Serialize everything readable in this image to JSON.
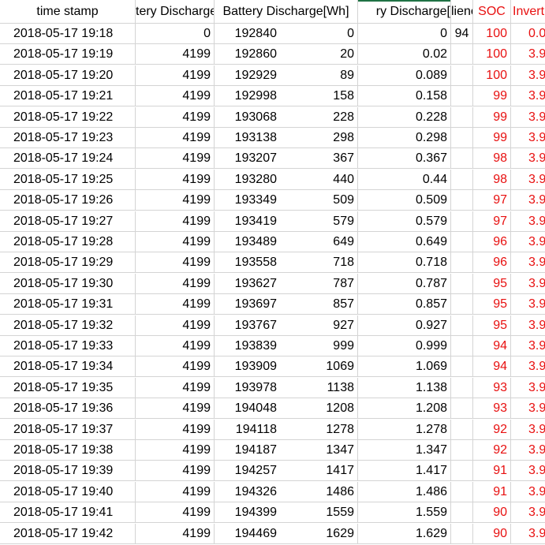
{
  "headers": {
    "timestamp": "time stamp",
    "col2": "tery Discharge",
    "col3": "Battery Discharge[Wh]",
    "col4": "ry Discharge[",
    "col5": "lienc",
    "soc": "SOC",
    "col7": "Invert"
  },
  "rows": [
    {
      "ts": "2018-05-17 19:18",
      "a": "0",
      "b": "192840",
      "c": "0",
      "d": "0",
      "e": "94",
      "soc": "100",
      "f": "0.0"
    },
    {
      "ts": "2018-05-17 19:19",
      "a": "4199",
      "b": "192860",
      "c": "20",
      "d": "0.02",
      "e": "",
      "soc": "100",
      "f": "3.9"
    },
    {
      "ts": "2018-05-17 19:20",
      "a": "4199",
      "b": "192929",
      "c": "89",
      "d": "0.089",
      "e": "",
      "soc": "100",
      "f": "3.9"
    },
    {
      "ts": "2018-05-17 19:21",
      "a": "4199",
      "b": "192998",
      "c": "158",
      "d": "0.158",
      "e": "",
      "soc": "99",
      "f": "3.9"
    },
    {
      "ts": "2018-05-17 19:22",
      "a": "4199",
      "b": "193068",
      "c": "228",
      "d": "0.228",
      "e": "",
      "soc": "99",
      "f": "3.9"
    },
    {
      "ts": "2018-05-17 19:23",
      "a": "4199",
      "b": "193138",
      "c": "298",
      "d": "0.298",
      "e": "",
      "soc": "99",
      "f": "3.9"
    },
    {
      "ts": "2018-05-17 19:24",
      "a": "4199",
      "b": "193207",
      "c": "367",
      "d": "0.367",
      "e": "",
      "soc": "98",
      "f": "3.9"
    },
    {
      "ts": "2018-05-17 19:25",
      "a": "4199",
      "b": "193280",
      "c": "440",
      "d": "0.44",
      "e": "",
      "soc": "98",
      "f": "3.9"
    },
    {
      "ts": "2018-05-17 19:26",
      "a": "4199",
      "b": "193349",
      "c": "509",
      "d": "0.509",
      "e": "",
      "soc": "97",
      "f": "3.9"
    },
    {
      "ts": "2018-05-17 19:27",
      "a": "4199",
      "b": "193419",
      "c": "579",
      "d": "0.579",
      "e": "",
      "soc": "97",
      "f": "3.9"
    },
    {
      "ts": "2018-05-17 19:28",
      "a": "4199",
      "b": "193489",
      "c": "649",
      "d": "0.649",
      "e": "",
      "soc": "96",
      "f": "3.9"
    },
    {
      "ts": "2018-05-17 19:29",
      "a": "4199",
      "b": "193558",
      "c": "718",
      "d": "0.718",
      "e": "",
      "soc": "96",
      "f": "3.9"
    },
    {
      "ts": "2018-05-17 19:30",
      "a": "4199",
      "b": "193627",
      "c": "787",
      "d": "0.787",
      "e": "",
      "soc": "95",
      "f": "3.9"
    },
    {
      "ts": "2018-05-17 19:31",
      "a": "4199",
      "b": "193697",
      "c": "857",
      "d": "0.857",
      "e": "",
      "soc": "95",
      "f": "3.9"
    },
    {
      "ts": "2018-05-17 19:32",
      "a": "4199",
      "b": "193767",
      "c": "927",
      "d": "0.927",
      "e": "",
      "soc": "95",
      "f": "3.9"
    },
    {
      "ts": "2018-05-17 19:33",
      "a": "4199",
      "b": "193839",
      "c": "999",
      "d": "0.999",
      "e": "",
      "soc": "94",
      "f": "3.9"
    },
    {
      "ts": "2018-05-17 19:34",
      "a": "4199",
      "b": "193909",
      "c": "1069",
      "d": "1.069",
      "e": "",
      "soc": "94",
      "f": "3.9"
    },
    {
      "ts": "2018-05-17 19:35",
      "a": "4199",
      "b": "193978",
      "c": "1138",
      "d": "1.138",
      "e": "",
      "soc": "93",
      "f": "3.9"
    },
    {
      "ts": "2018-05-17 19:36",
      "a": "4199",
      "b": "194048",
      "c": "1208",
      "d": "1.208",
      "e": "",
      "soc": "93",
      "f": "3.9"
    },
    {
      "ts": "2018-05-17 19:37",
      "a": "4199",
      "b": "194118",
      "c": "1278",
      "d": "1.278",
      "e": "",
      "soc": "92",
      "f": "3.9"
    },
    {
      "ts": "2018-05-17 19:38",
      "a": "4199",
      "b": "194187",
      "c": "1347",
      "d": "1.347",
      "e": "",
      "soc": "92",
      "f": "3.9"
    },
    {
      "ts": "2018-05-17 19:39",
      "a": "4199",
      "b": "194257",
      "c": "1417",
      "d": "1.417",
      "e": "",
      "soc": "91",
      "f": "3.9"
    },
    {
      "ts": "2018-05-17 19:40",
      "a": "4199",
      "b": "194326",
      "c": "1486",
      "d": "1.486",
      "e": "",
      "soc": "91",
      "f": "3.9"
    },
    {
      "ts": "2018-05-17 19:41",
      "a": "4199",
      "b": "194399",
      "c": "1559",
      "d": "1.559",
      "e": "",
      "soc": "90",
      "f": "3.9"
    },
    {
      "ts": "2018-05-17 19:42",
      "a": "4199",
      "b": "194469",
      "c": "1629",
      "d": "1.629",
      "e": "",
      "soc": "90",
      "f": "3.9"
    }
  ],
  "colors": {
    "red_text": "#e81010",
    "grid_line": "#d4d4d4",
    "selection": "#1f7244"
  }
}
